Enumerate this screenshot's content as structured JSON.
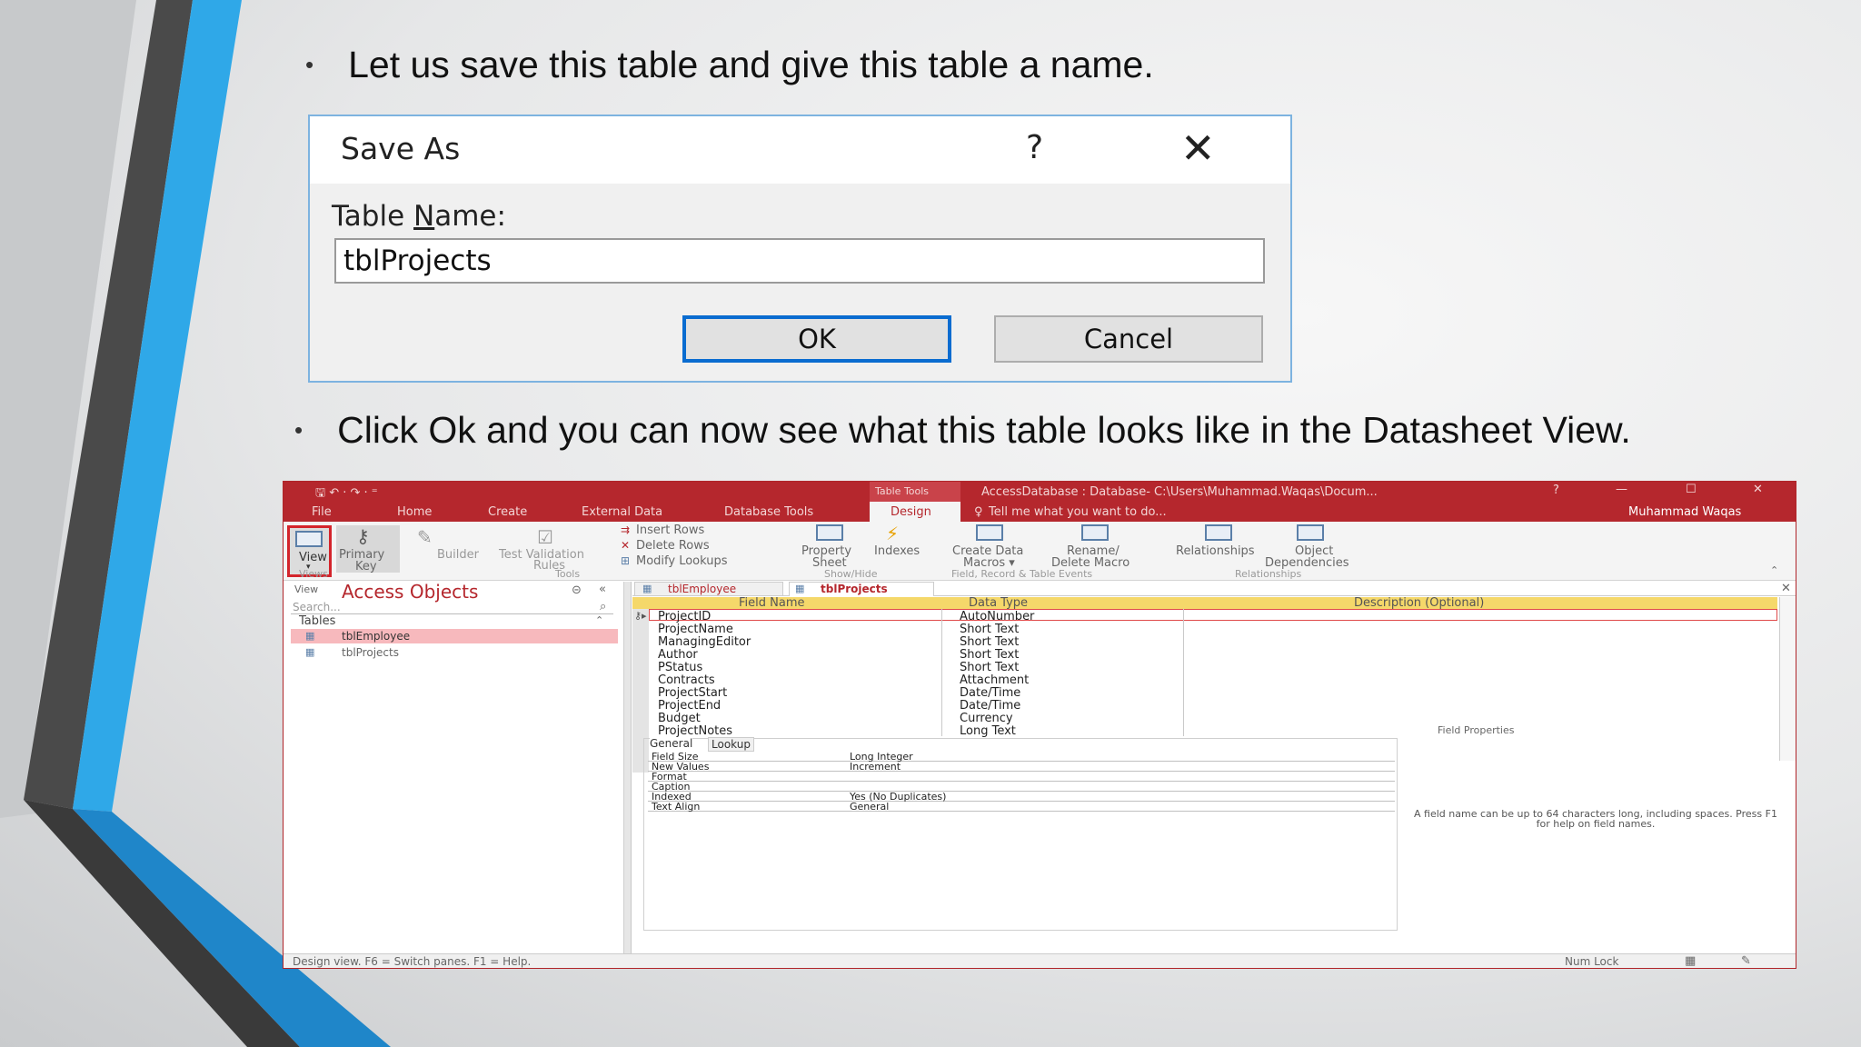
{
  "slide": {
    "bullet1": "Let us save this table and give this table a name.",
    "bullet2": "Click Ok and you can now see what this table looks like in the Datasheet View.",
    "bullet_symbol": "•"
  },
  "save_dialog": {
    "title": "Save As",
    "help": "?",
    "close": "✕",
    "label_pre": "Table ",
    "label_u": "N",
    "label_post": "ame:",
    "value": "tblProjects",
    "ok": "OK",
    "cancel": "Cancel"
  },
  "access": {
    "tool_context": "Table Tools",
    "window_title": "AccessDatabase : Database- C:\\Users\\Muhammad.Waqas\\Docum...",
    "win_help": "?",
    "win_min": "—",
    "win_max": "☐",
    "win_close": "✕",
    "quick_access": "🖫  ↶ ·  ↷ ·  ⁼",
    "tabs": [
      "File",
      "Home",
      "Create",
      "External Data",
      "Database Tools",
      "Design"
    ],
    "tell_me": "Tell me what you want to do...",
    "user": "Muhammad Waqas",
    "ribbon": {
      "view": "View",
      "primary_key_1": "Primary",
      "primary_key_2": "Key",
      "builder": "Builder",
      "test_1": "Test",
      "test_2": "Validation",
      "test_3": "Rules",
      "insert_rows": "Insert Rows",
      "delete_rows": "Delete Rows",
      "modify_lookups": "Modify Lookups",
      "property_1": "Property",
      "property_2": "Sheet",
      "indexes": "Indexes",
      "create_data_1": "Create Data",
      "create_data_2": "Macros ▾",
      "rename_1": "Rename/",
      "rename_2": "Delete Macro",
      "relationships": "Relationships",
      "object_1": "Object",
      "object_2": "Dependencies",
      "groups": [
        "Views",
        "Tools",
        "Show/Hide",
        "Field, Record & Table Events",
        "Relationships"
      ]
    },
    "nav": {
      "view_label": "View",
      "title": "Access Objects",
      "search": "Search...",
      "section": "Tables",
      "items": [
        "tblEmployee",
        "tblProjects"
      ]
    },
    "doc_tabs": [
      "tblEmployee",
      "tblProjects"
    ],
    "grid": {
      "headers": [
        "Field Name",
        "Data Type",
        "Description (Optional)"
      ],
      "rows": [
        [
          "ProjectID",
          "AutoNumber"
        ],
        [
          "ProjectName",
          "Short Text"
        ],
        [
          "ManagingEditor",
          "Short Text"
        ],
        [
          "Author",
          "Short Text"
        ],
        [
          "PStatus",
          "Short Text"
        ],
        [
          "Contracts",
          "Attachment"
        ],
        [
          "ProjectStart",
          "Date/Time"
        ],
        [
          "ProjectEnd",
          "Date/Time"
        ],
        [
          "Budget",
          "Currency"
        ],
        [
          "ProjectNotes",
          "Long Text"
        ]
      ]
    },
    "field_properties": {
      "title": "Field Properties",
      "tabs": [
        "General",
        "Lookup"
      ],
      "rows": [
        [
          "Field Size",
          "Long Integer"
        ],
        [
          "New Values",
          "Increment"
        ],
        [
          "Format",
          ""
        ],
        [
          "Caption",
          ""
        ],
        [
          "Indexed",
          "Yes (No Duplicates)"
        ],
        [
          "Text Align",
          "General"
        ]
      ],
      "help_text": "A field name can be up to 64 characters long, including spaces. Press F1 for help on field names."
    },
    "status": {
      "left": "Design view.  F6 = Switch panes.  F1 = Help.",
      "num_lock": "Num Lock"
    }
  }
}
